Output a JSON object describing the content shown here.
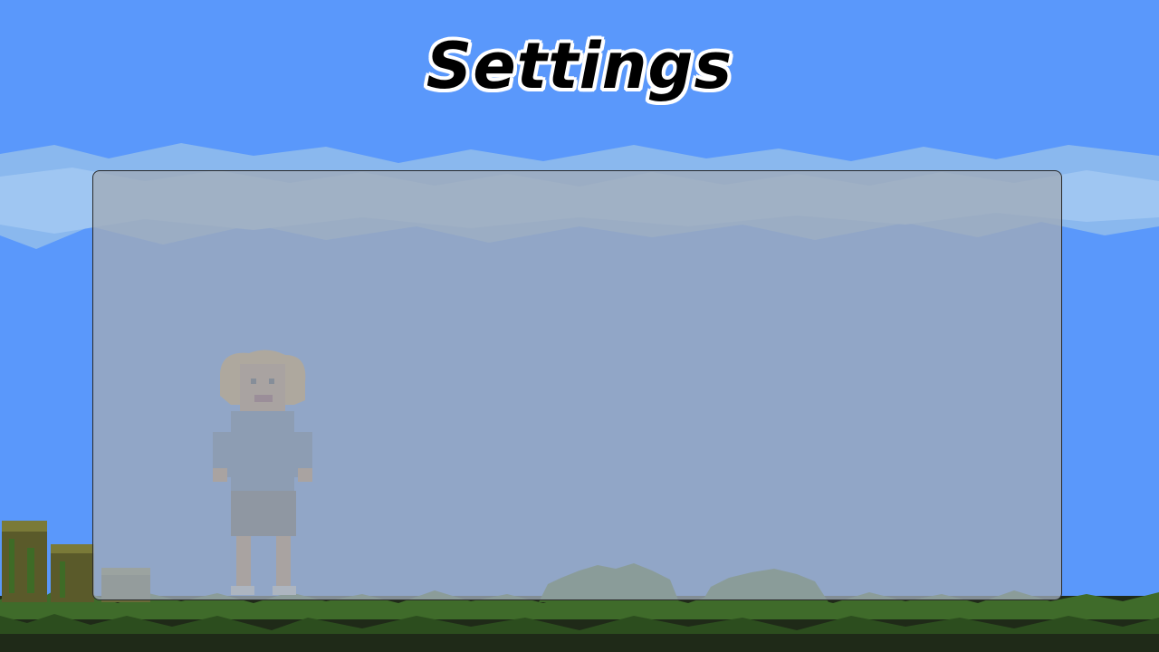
{
  "screen": {
    "title": "Settings"
  },
  "colors": {
    "sky": "#5a98fb",
    "cloud": "#8ab8ee",
    "grass": "#3f6b2a",
    "panel_overlay": "#a0aab9"
  }
}
